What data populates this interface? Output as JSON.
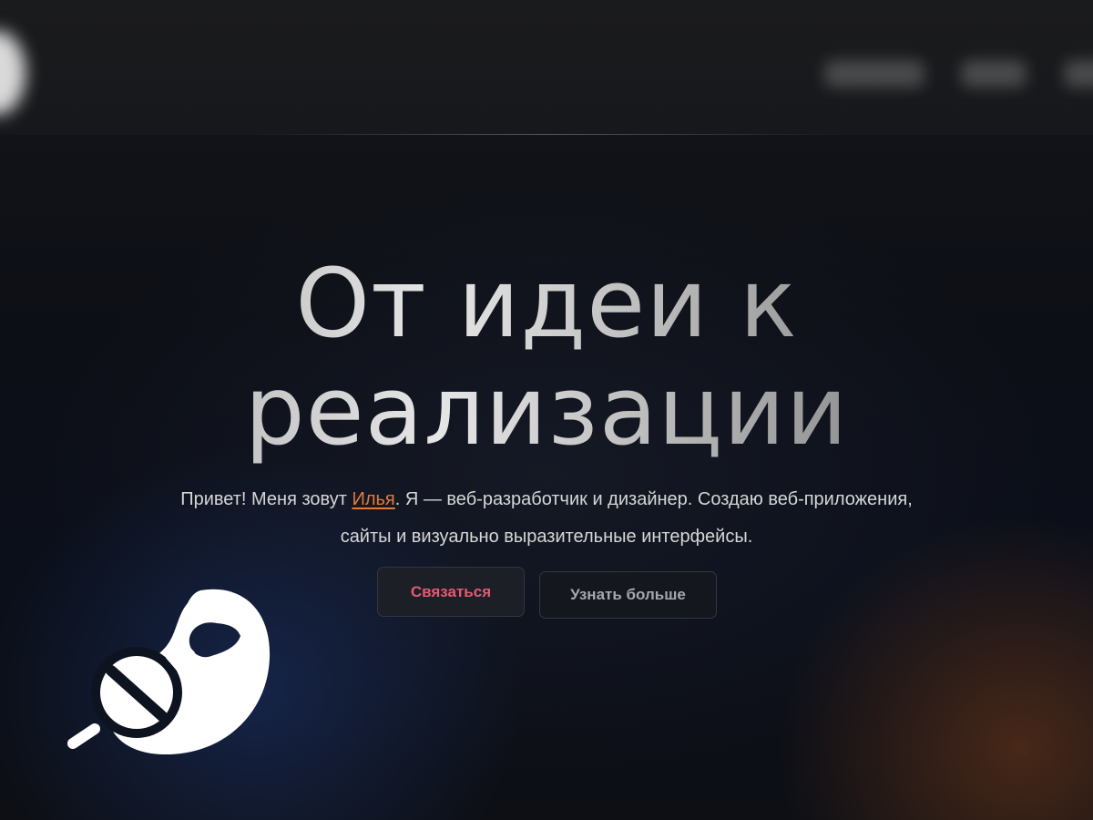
{
  "header": {
    "nav": [
      {
        "label": ""
      },
      {
        "label": ""
      },
      {
        "label": ""
      }
    ]
  },
  "hero": {
    "title_line1": "От идеи к",
    "title_line2": "реализации",
    "intro_before": "Привет! Меня зовут ",
    "intro_name": "Илья",
    "intro_after": ". Я — веб-разработчик и дизайнер. Создаю веб-приложения, сайты и визуально выразительные интерфейсы.",
    "contact_button": "Связаться",
    "more_button": "Узнать больше"
  },
  "icons": {
    "overlay_logo": "paintbrush-icon"
  },
  "colors": {
    "background": "#0d0f15",
    "accent_name": "#e27a3a",
    "contact_text": "#e35a72"
  }
}
